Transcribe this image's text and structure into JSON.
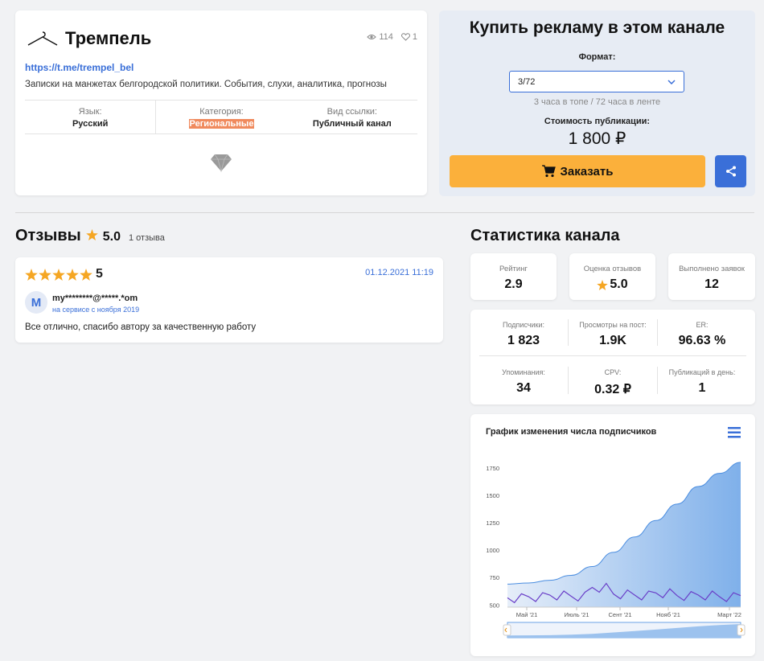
{
  "channel": {
    "title": "Трем­пель",
    "views": "114",
    "likes": "1",
    "link": "https://t.me/trempel_bel",
    "description": "Записки на манжетах белгородской политики. События, слухи, аналитика, прогнозы",
    "meta": [
      {
        "label": "Язык:",
        "value": "Русский"
      },
      {
        "label": "Категория:",
        "value": "Региональные"
      },
      {
        "label": "Вид ссылки:",
        "value": "Публичный канал"
      }
    ]
  },
  "buy": {
    "title": "Купить рекламу в этом канале",
    "format_label": "Формат:",
    "format_value": "3/72",
    "format_hint": "3 часа в топе / 72 часа в ленте",
    "cost_label": "Стоимость публикации:",
    "cost_value": "1 800 ₽",
    "order_label": "Заказать"
  },
  "reviews": {
    "title": "Отзывы",
    "rating": "5.0",
    "count": "1 отзыва",
    "items": [
      {
        "score": "5",
        "stars": 5,
        "date": "01.12.2021 11:19",
        "avatar": "M",
        "user": "my********@*****.*om",
        "since": "на сервисе с ноября 2019",
        "text": "Все отлично, спасибо автору за качественную работу"
      }
    ]
  },
  "stats": {
    "title": "Статистика канала",
    "top": [
      {
        "label": "Рейтинг",
        "value": "2.9"
      },
      {
        "label": "Оценка отзывов",
        "value": "5.0"
      },
      {
        "label": "Выполнено заявок",
        "value": "12"
      }
    ],
    "grid": [
      {
        "label": "Подписчики:",
        "value": "1 823"
      },
      {
        "label": "Просмотры на пост:",
        "value": "1.9K"
      },
      {
        "label": "ER:",
        "value": "96.63 %"
      },
      {
        "label": "Упоминания:",
        "value": "34"
      },
      {
        "label": "CPV:",
        "value": "0.32 ₽"
      },
      {
        "label": "Публикаций в день:",
        "value": "1"
      }
    ]
  },
  "colors": {
    "accent": "#3a6fd8",
    "order_button": "#fbb03b",
    "category_highlight": "#f08a5d",
    "area_fill": "#7fb0ea",
    "views_line": "#6a3fc8"
  },
  "chart_data": {
    "type": "area",
    "title": "График изменения числа подписчиков",
    "x_ticks": [
      "Май '21",
      "Июль '21",
      "Сент '21",
      "Нояб '21",
      "Март '22"
    ],
    "y_ticks": [
      500,
      750,
      1000,
      1250,
      1500,
      1750
    ],
    "ylim": [
      480,
      1800
    ],
    "series": [
      {
        "x": [
          "Апр '21",
          "Май '21",
          "Июнь '21",
          "Июль '21",
          "Авг '21",
          "Сент '21",
          "Окт '21",
          "Нояб '21",
          "Дек '21",
          "Янв '22",
          "Фев '22",
          "Март '22"
        ],
        "values": [
          690,
          700,
          725,
          770,
          850,
          980,
          1120,
          1270,
          1420,
          1580,
          1700,
          1800
        ]
      },
      {
        "x": [
          "Апр '21",
          "Май '21",
          "Июнь '21",
          "Июль '21",
          "Авг '21",
          "Сент '21",
          "Окт '21",
          "Нояб '21",
          "Дек '21",
          "Янв '22",
          "Фев '22",
          "Март '22"
        ],
        "values": [
          565,
          575,
          590,
          580,
          660,
          600,
          590,
          610,
          585,
          590,
          575,
          585
        ]
      }
    ],
    "legend": "none",
    "grid": false
  }
}
